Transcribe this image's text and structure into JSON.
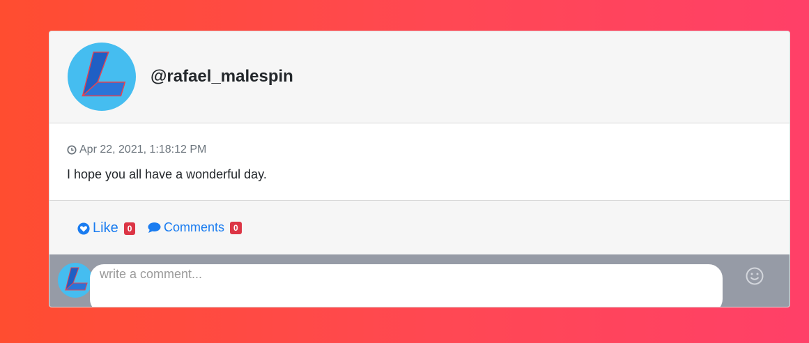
{
  "post": {
    "username": "@rafael_malespin",
    "timestamp": "Apr 22, 2021, 1:18:12 PM",
    "text": "I hope you all have a wonderful day."
  },
  "actions": {
    "like_label": "Like",
    "like_count": "0",
    "comments_label": "Comments",
    "comments_count": "0"
  },
  "comment_box": {
    "placeholder": "write a comment..."
  },
  "icons": {
    "avatar": "lightning-logo-icon",
    "timestamp": "clock-icon",
    "like": "heart-icon",
    "comments": "speech-bubble-icon",
    "emoji": "smiley-icon"
  },
  "colors": {
    "accent": "#1a7cf0",
    "badge": "#dc3545",
    "avatar_bg": "#45bdf0"
  }
}
